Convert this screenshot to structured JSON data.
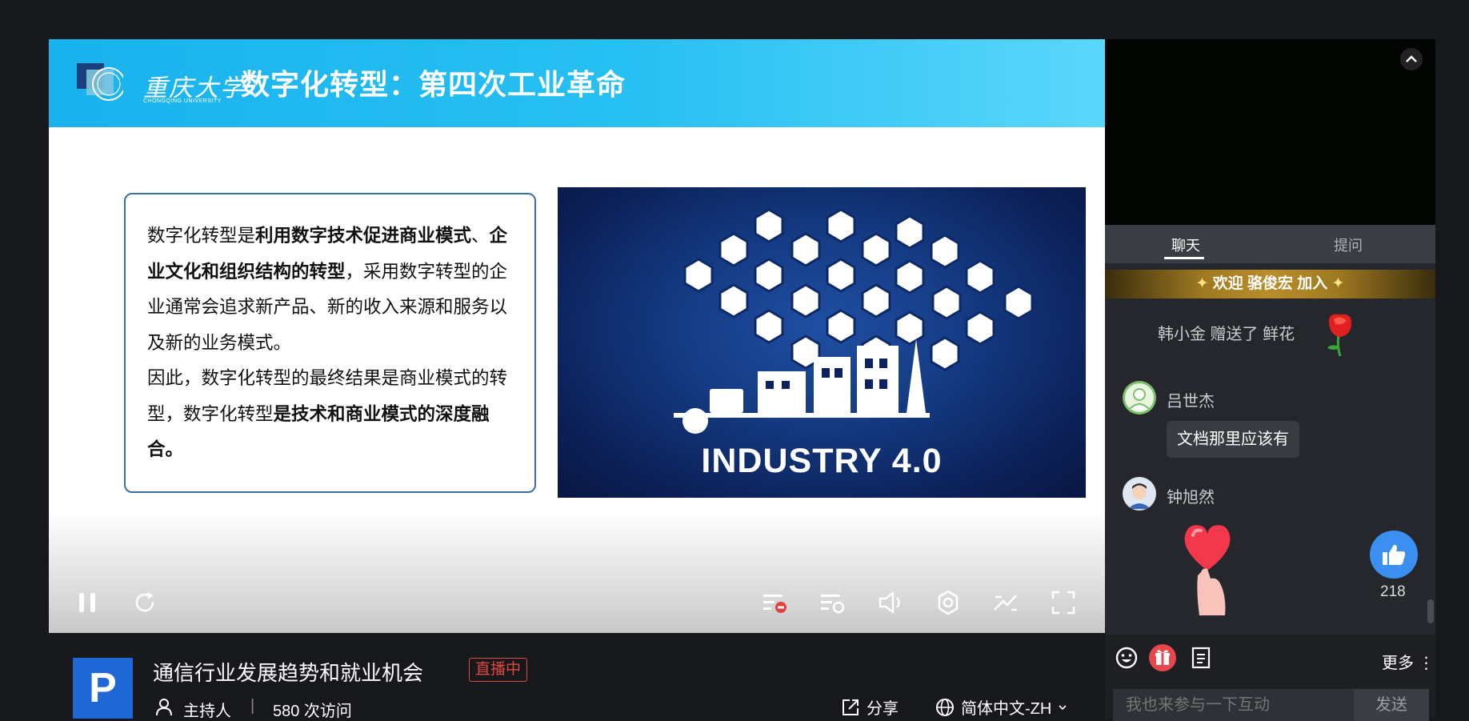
{
  "slide": {
    "logo_text": "重庆大学",
    "logo_sub": "CHONGQING UNIVERSITY",
    "title": "数字化转型：第四次工业革命",
    "para1_a": "数字化转型是",
    "para1_b": "利用数字技术促进商业模式",
    "para1_c": "、",
    "para1_d": "企业文化和组织结构的转型",
    "para1_e": "，采用数字转型的企业通常会追求新产品、新的收入来源和服务以及新的业务模式。",
    "para2_a": "因此，数字化转型的最终结果是商业模式的转型，数字化转型",
    "para2_b": "是技术和商业模式的深度融合",
    "para2_c": "。",
    "image_label": "INDUSTRY 4.0"
  },
  "player_controls": {
    "icons": [
      "pause-icon",
      "replay-icon",
      "danmaku-off-icon",
      "danmaku-settings-icon",
      "volume-icon",
      "settings-icon",
      "pip-icon",
      "fullscreen-icon"
    ]
  },
  "info": {
    "logo_letter": "P",
    "title": "通信行业发展趋势和就业机会",
    "live_badge": "直播中",
    "host": "主持人",
    "separator": "|",
    "visits": "580 次访问",
    "share": "分享",
    "language": "简体中文-ZH"
  },
  "sidebar": {
    "tabs": [
      {
        "label": "聊天"
      },
      {
        "label": "提问"
      }
    ],
    "welcome": "欢迎  骆俊宏  加入",
    "gift_message": "韩小金 赠送了 鲜花",
    "messages": [
      {
        "name": "吕世杰",
        "text": "文档那里应该有"
      },
      {
        "name": "钟旭然"
      }
    ],
    "likes": "218",
    "more": "更多",
    "input_placeholder": "我也来参与一下互动",
    "send": "发送"
  },
  "colors": {
    "header_blue": "#1ab2ee",
    "live_red": "#e0473e",
    "like_blue": "#3b8ff0",
    "brand_blue": "#1f66d6"
  }
}
